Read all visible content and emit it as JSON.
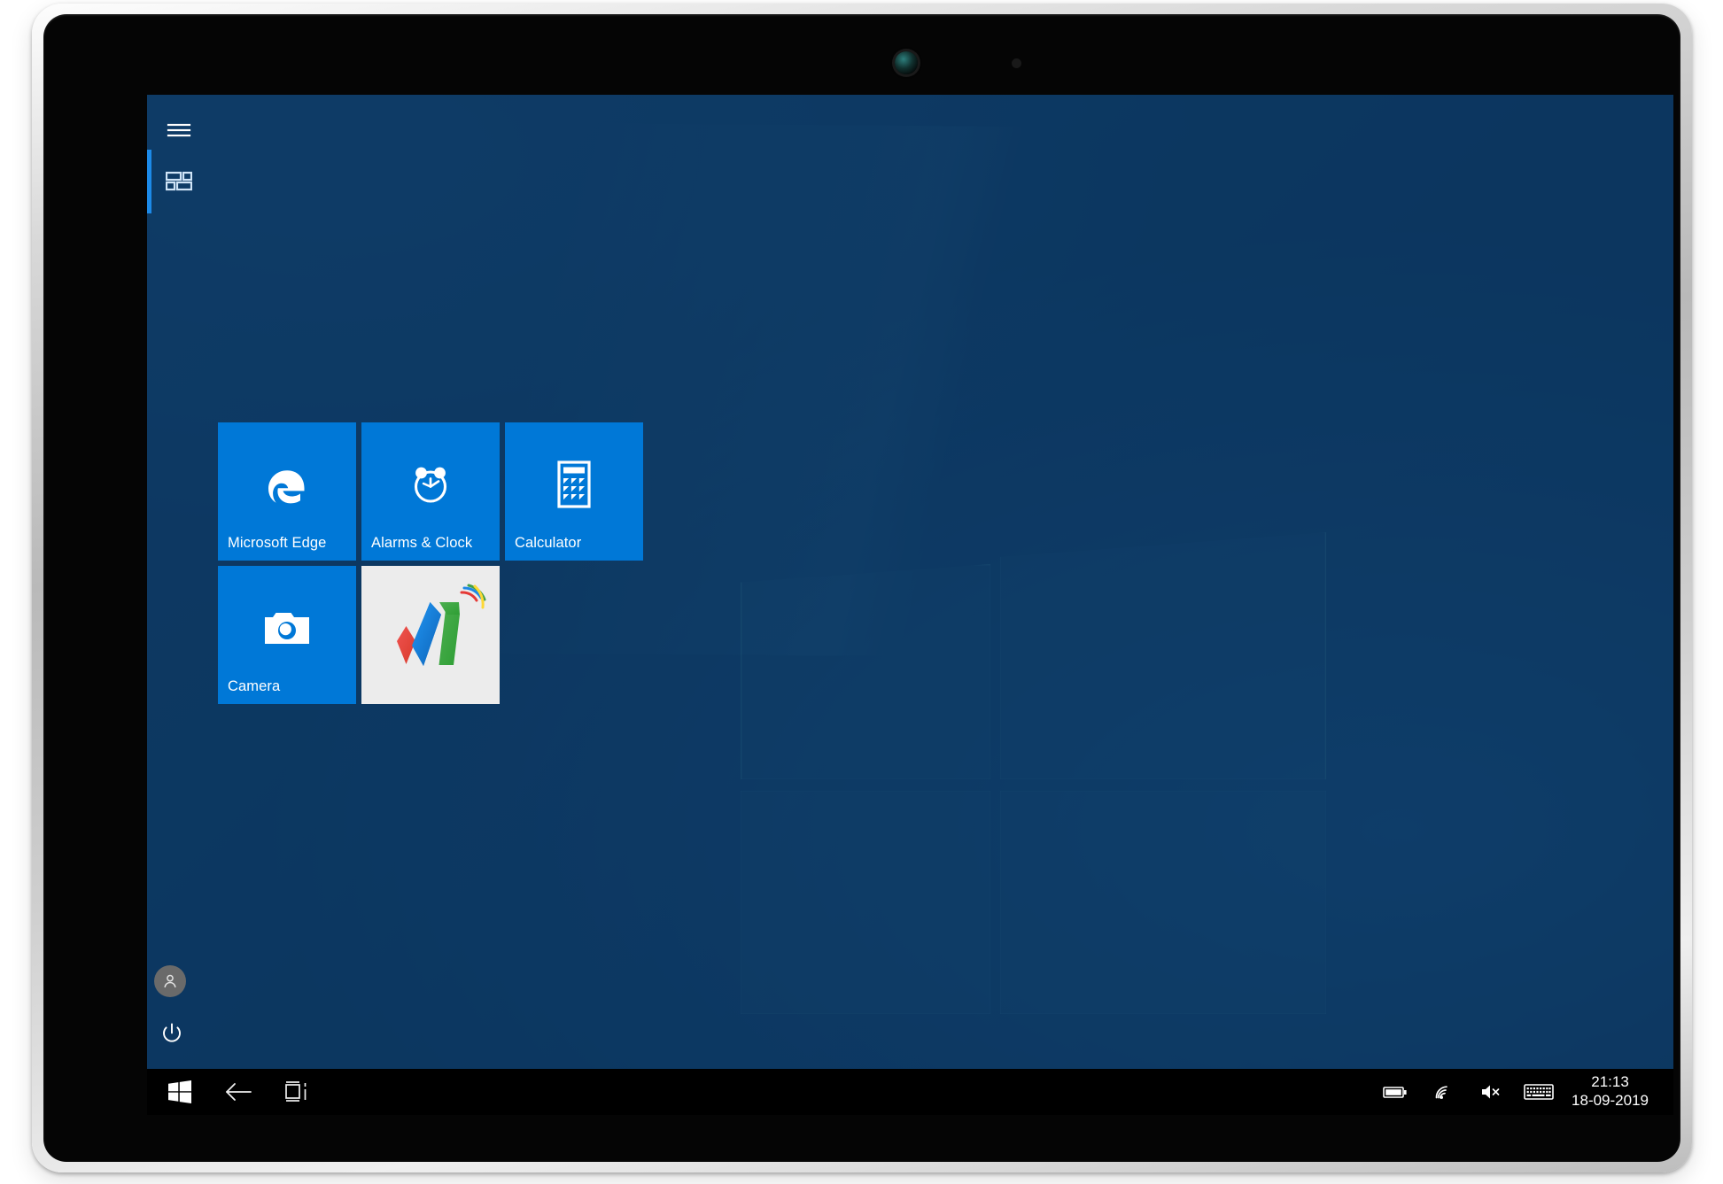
{
  "device": {
    "type": "tablet",
    "webcam_icon": "webcam-lens",
    "sensor_icon": "ambient-light-sensor"
  },
  "start_screen": {
    "rail": {
      "menu_label": "Expand",
      "menu_icon": "hamburger-menu-icon",
      "tiles_icon": "tiles-view-icon",
      "user_icon": "user-account-icon",
      "power_icon": "power-icon",
      "accent_color": "#1c8ae8"
    },
    "panel_color": "#0d3862",
    "tile_color": "#0078d7",
    "tiles": [
      {
        "label": "Microsoft Edge",
        "icon": "edge-icon",
        "style": "blue"
      },
      {
        "label": "Alarms & Clock",
        "icon": "alarm-clock-icon",
        "style": "blue"
      },
      {
        "label": "Calculator",
        "icon": "calculator-icon",
        "style": "blue"
      },
      {
        "label": "Camera",
        "icon": "camera-icon",
        "style": "blue"
      },
      {
        "label": "",
        "icon": "office-suite-logo-icon",
        "style": "light"
      }
    ]
  },
  "taskbar": {
    "background": "#000000",
    "start_icon": "windows-start-icon",
    "back_icon": "back-arrow-icon",
    "task_view_icon": "task-view-icon",
    "tray": {
      "battery_icon": "battery-icon",
      "network_icon": "wifi-icon",
      "volume_icon": "volume-muted-icon",
      "keyboard_icon": "touch-keyboard-icon"
    },
    "clock": {
      "time": "21:13",
      "date": "18-09-2019"
    }
  }
}
